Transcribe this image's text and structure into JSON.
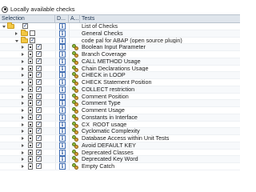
{
  "radio": {
    "label": "Locally available checks",
    "selected": true
  },
  "header": {
    "selection": "Selection",
    "documentation": "D...",
    "attributes": "A...",
    "tests": "Tests"
  },
  "rows": [
    {
      "text": "List of Checks",
      "kind": "root",
      "expander": "down",
      "checked": true,
      "doc": false,
      "attr": false
    },
    {
      "text": "General Checks",
      "kind": "folder",
      "expander": "right",
      "checked": false,
      "doc": false,
      "attr": false
    },
    {
      "text": "code pal for ABAP (open source plugin)",
      "kind": "folder",
      "expander": "down",
      "checked": true,
      "doc": false,
      "attr": false
    },
    {
      "text": "Boolean Input Parameter",
      "kind": "check",
      "expander": "right",
      "checked": true,
      "doc": true,
      "attr": true
    },
    {
      "text": "Branch Coverage",
      "kind": "check",
      "expander": "right",
      "checked": true,
      "doc": true,
      "attr": true
    },
    {
      "text": "CALL METHOD Usage",
      "kind": "check",
      "expander": "right",
      "checked": true,
      "doc": true,
      "attr": true
    },
    {
      "text": "Chain Declarations Usage",
      "kind": "check",
      "expander": "right",
      "checked": true,
      "doc": true,
      "attr": true
    },
    {
      "text": "CHECK in LOOP",
      "kind": "check",
      "expander": "right",
      "checked": true,
      "doc": true,
      "attr": true
    },
    {
      "text": "CHECK Statement Position",
      "kind": "check",
      "expander": "right",
      "checked": true,
      "doc": true,
      "attr": true
    },
    {
      "text": "COLLECT restriction",
      "kind": "check",
      "expander": "right",
      "checked": true,
      "doc": true,
      "attr": true
    },
    {
      "text": "Comment Position",
      "kind": "check",
      "expander": "right",
      "checked": true,
      "doc": true,
      "attr": true
    },
    {
      "text": "Comment Type",
      "kind": "check",
      "expander": "right",
      "checked": true,
      "doc": true,
      "attr": true
    },
    {
      "text": "Comment Usage",
      "kind": "check",
      "expander": "right",
      "checked": true,
      "doc": true,
      "attr": true
    },
    {
      "text": "Constants in Interface",
      "kind": "check",
      "expander": "right",
      "checked": true,
      "doc": true,
      "attr": true
    },
    {
      "text": "CX_ROOT usage",
      "kind": "check",
      "expander": "right",
      "checked": true,
      "doc": true,
      "attr": true
    },
    {
      "text": "Cyclomatic Complexity",
      "kind": "check",
      "expander": "right",
      "checked": true,
      "doc": true,
      "attr": true
    },
    {
      "text": "Database Access within Unit Tests",
      "kind": "check",
      "expander": "right",
      "checked": true,
      "doc": true,
      "attr": true
    },
    {
      "text": "Avoid DEFAULT KEY",
      "kind": "check",
      "expander": "right",
      "checked": true,
      "doc": true,
      "attr": true
    },
    {
      "text": "Deprecated Classes",
      "kind": "check",
      "expander": "right",
      "checked": true,
      "doc": true,
      "attr": true
    },
    {
      "text": "Deprecated Key Word",
      "kind": "check",
      "expander": "right",
      "checked": true,
      "doc": true,
      "attr": true
    },
    {
      "text": "Empty Catch",
      "kind": "check",
      "expander": "right",
      "checked": true,
      "doc": true,
      "attr": true
    }
  ]
}
